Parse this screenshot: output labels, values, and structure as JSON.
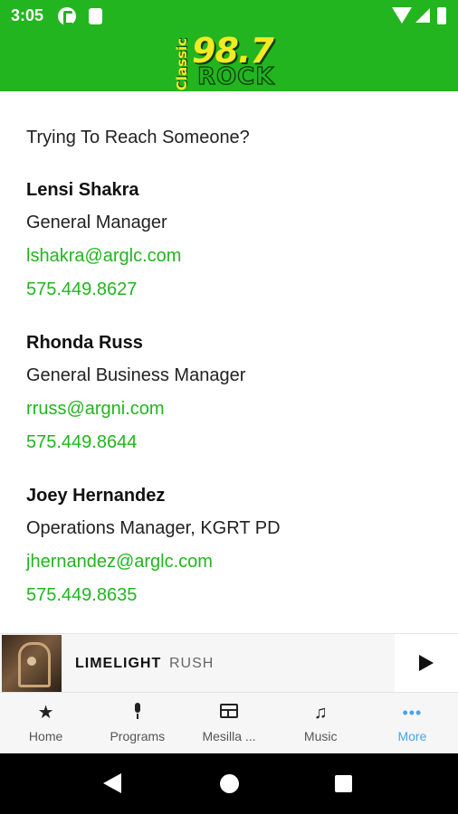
{
  "status_bar": {
    "time": "3:05"
  },
  "header": {
    "logo": {
      "classic": "Classic",
      "frequency": "98.7",
      "rock": "ROCK"
    },
    "background_color": "#22b51f"
  },
  "content": {
    "intro": "Trying To Reach Someone?",
    "contacts": [
      {
        "name": "Lensi Shakra",
        "role": "General Manager",
        "email": "lshakra@arglc.com",
        "phone": "575.449.8627"
      },
      {
        "name": "Rhonda Russ",
        "role": "General Business Manager",
        "email": "rruss@argni.com",
        "phone": "575.449.8644"
      },
      {
        "name": "Joey Hernandez",
        "role": "Operations Manager, KGRT PD",
        "email": "jhernandez@arglc.com",
        "phone": "575.449.8635"
      }
    ]
  },
  "player": {
    "song": "LIMELIGHT",
    "artist": "RUSH",
    "play_icon": "play-icon"
  },
  "nav": {
    "tabs": [
      {
        "label": "Home",
        "icon": "star-icon"
      },
      {
        "label": "Programs",
        "icon": "microphone-icon"
      },
      {
        "label": "Mesilla ...",
        "icon": "calendar-icon"
      },
      {
        "label": "Music",
        "icon": "music-note-icon"
      },
      {
        "label": "More",
        "icon": "more-dots-icon",
        "active": true
      }
    ],
    "active_color": "#4aa3e8"
  }
}
